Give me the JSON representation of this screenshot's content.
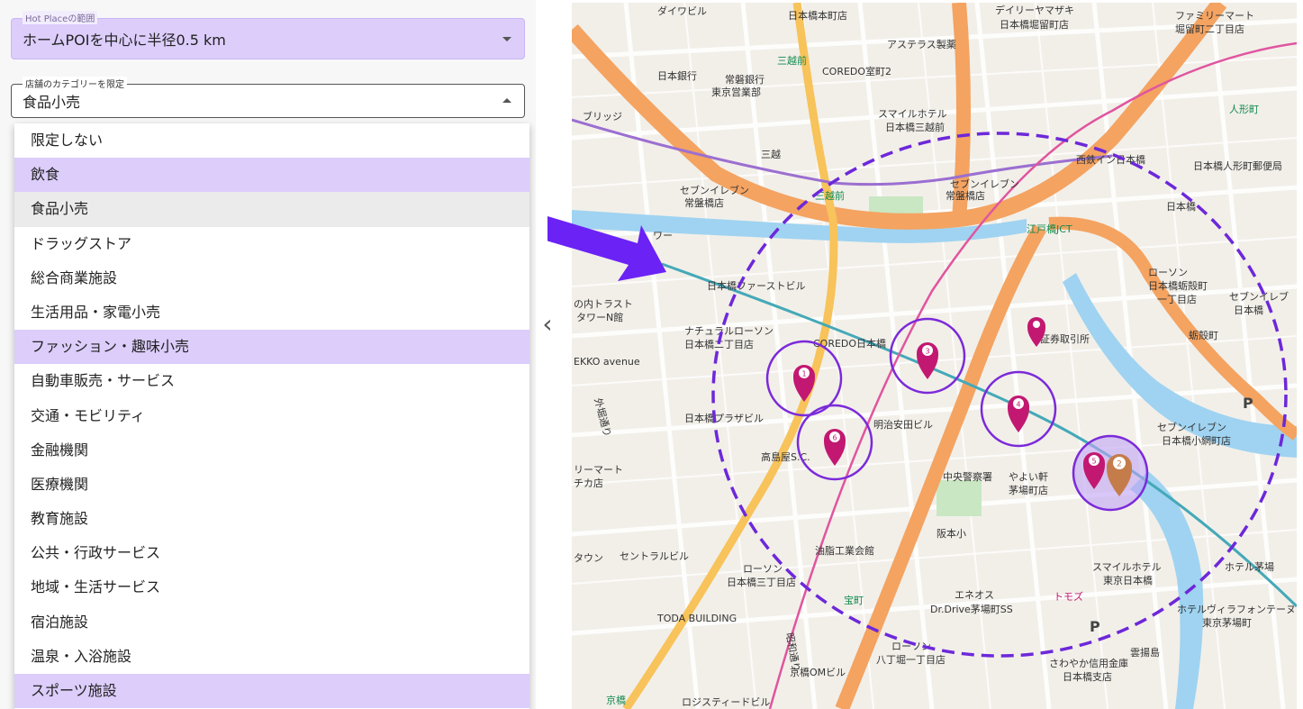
{
  "hot_place": {
    "legend": "Hot Placeの範囲",
    "value": "ホームPOIを中心に半径0.5 km"
  },
  "category": {
    "legend": "店舗のカテゴリーを限定",
    "value": "食品小売"
  },
  "options": [
    {
      "label": "限定しない",
      "state": "normal"
    },
    {
      "label": "飲食",
      "state": "selected"
    },
    {
      "label": "食品小売",
      "state": "hover"
    },
    {
      "label": "ドラッグストア",
      "state": "normal"
    },
    {
      "label": "総合商業施設",
      "state": "normal"
    },
    {
      "label": "生活用品・家電小売",
      "state": "normal"
    },
    {
      "label": "ファッション・趣味小売",
      "state": "selected"
    },
    {
      "label": "自動車販売・サービス",
      "state": "normal"
    },
    {
      "label": "交通・モビリティ",
      "state": "normal"
    },
    {
      "label": "金融機関",
      "state": "normal"
    },
    {
      "label": "医療機関",
      "state": "normal"
    },
    {
      "label": "教育施設",
      "state": "normal"
    },
    {
      "label": "公共・行政サービス",
      "state": "normal"
    },
    {
      "label": "地域・生活サービス",
      "state": "normal"
    },
    {
      "label": "宿泊施設",
      "state": "normal"
    },
    {
      "label": "温泉・入浴施設",
      "state": "normal"
    },
    {
      "label": "スポーツ施設",
      "state": "selected"
    }
  ],
  "collapse_icon": "chevron-left-icon",
  "map": {
    "labels": [
      "ダイワビル",
      "日本橋本町店",
      "デイリーヤマザキ",
      "日本橋堀留町店",
      "ファミリーマート",
      "堀留町二丁目店",
      "日本銀行",
      "常磐銀行",
      "東京営業部",
      "三越前",
      "COREDO室町2",
      "アステラス製薬",
      "スマイルホテル",
      "日本橋三越前",
      "人形町",
      "ブリッジ",
      "三越",
      "西鉄イン日本橋",
      "日本橋人形町郵便局",
      "セブンイレブン",
      "常盤橋店",
      "日本橋本町1丁目店",
      "日本橋",
      "江戸橋JCT",
      "ワー",
      "日本橋ファーストビル",
      "ローソン",
      "日本橋蛎殻町",
      "一丁目店",
      "セブンイレブ",
      "日本橋",
      "の内トラスト",
      "タワーN館",
      "ナチュラルローソン",
      "日本橋二丁目店",
      "COREDO日本橋",
      "証券取引所",
      "蛎殻町",
      "EKKO avenue",
      "日本橋プラザビル",
      "明治安田ビル",
      "高島屋S.C.",
      "中央警察署",
      "やよい軒",
      "茅場町店",
      "日本橋小網町店",
      "リーマート",
      "チカ店",
      "阪本小",
      "タウン",
      "セントラルビル",
      "油脂工業会館",
      "日本橋三丁目店",
      "スマイルホテル",
      "東京日本橋",
      "ホテル茅場",
      "宝町",
      "エネオス",
      "Dr.Drive茅場町SS",
      "トモズ",
      "ホテルヴィラフォンテーヌ",
      "東京茅場町",
      "TODA BUILDING",
      "八丁堀一丁目店",
      "さわやか信用金庫",
      "日本橋支店",
      "京橋OMビル",
      "京橋",
      "ロジスティードビル",
      "雲揚島",
      "外堀通り",
      "昭和通り"
    ],
    "markers": [
      "1",
      "2",
      "3",
      "4",
      "5",
      "6"
    ],
    "accent_colors": {
      "marker": "#c21871",
      "marker_alt": "#c47c4b",
      "circle": "#6d28d9",
      "arrow": "#6b22f5",
      "expressway": "#f4a361",
      "major_road": "#f7c35a"
    },
    "icons": [
      "arrow-right-icon",
      "map-pin-icon",
      "parking-icon",
      "shopping-bag-icon",
      "train-station-icon"
    ]
  }
}
